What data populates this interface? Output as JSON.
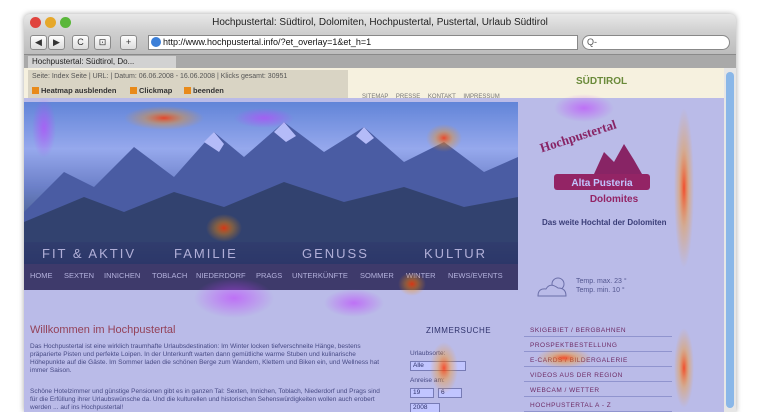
{
  "window": {
    "title": "Hochpustertal: Südtirol, Dolomiten, Hochpustertal, Pustertal, Urlaub Südtirol"
  },
  "toolbar": {
    "url": "http://www.hochpustertal.info/?et_overlay=1&et_h=1",
    "search_placeholder": "Q-",
    "back_label": "◀",
    "forward_label": "▶",
    "reload_label": "C",
    "view_label": "⊡",
    "add_label": "+"
  },
  "tab": {
    "label": "Hochpustertal: Südtirol, Do..."
  },
  "overlay": {
    "info": "Seite: Index Seite | URL: | Datum: 06.06.2008 - 16.06.2008 | Klicks gesamt: 30951",
    "heatmap_btn": "Heatmap ausblenden",
    "clickmap_btn": "Clickmap",
    "close_btn": "beenden"
  },
  "site": {
    "topnav": "SITEMAP PRESSE KONTAKT IMPRESSUM",
    "suedtirol": "SÜDTIROL",
    "logo_line1": "Hochpustertal",
    "logo_line2": "Alta Pusteria",
    "logo_line3": "Dolomites",
    "logo_caption": "Das weite Hochtal der Dolomiten",
    "categories": [
      "FIT & AKTIV",
      "FAMILIE",
      "GENUSS",
      "KULTUR"
    ],
    "subnav": [
      "HOME",
      "SEXTEN",
      "INNICHEN",
      "TOBLACH",
      "NIEDERDORF",
      "PRAGS",
      "UNTERKÜNFTE",
      "SOMMER",
      "WINTER",
      "NEWS/EVENTS"
    ],
    "temp_max": "Temp. max. 23 °",
    "temp_min": "Temp. min. 10 °",
    "welcome_title": "Willkommen im Hochpustertal",
    "welcome_p1": "Das Hochpustertal ist eine wirklich traumhafte Urlaubsdestination: Im Winter locken tiefverschneite Hänge, bestens präparierte Pisten und perfekte Loipen. In der Unterkunft warten dann gemütliche warme Stuben und kulinarische Höhepunkte auf die Gäste. Im Sommer laden die schönen Berge zum Wandern, Klettern und Biken ein, und Wellness hat immer Saison.",
    "welcome_p2": "Schöne Hotelzimmer und günstige Pensionen gibt es in ganzen Tal: Sexten, Innichen, Toblach, Niederdorf und Prags sind für die Erfüllung ihrer Urlaubswünsche da. Und die kulturellen und historischen Sehenswürdigkeiten wollen auch erobert werden ... auf ins Hochpustertal!",
    "zimmer_title": "ZIMMERSUCHE",
    "urlaubsorte_label": "Urlaubsorte:",
    "urlaubsorte_value": "Alle",
    "anreise_label": "Anreise am:",
    "day_value": "19",
    "month_value": "6",
    "year_value": "2008",
    "links": [
      "SKIGEBIET / BERGBAHNEN",
      "PROSPEKTBESTELLUNG",
      "E-CARDS / BILDERGALERIE",
      "VIDEOS AUS DER REGION",
      "WEBCAM / WETTER",
      "HOCHPUSTERTAL A - Z"
    ]
  },
  "colors": {
    "accent": "#c04a1a",
    "heat_hot": "#ff2a00",
    "heat_cold": "#1a2aff"
  }
}
